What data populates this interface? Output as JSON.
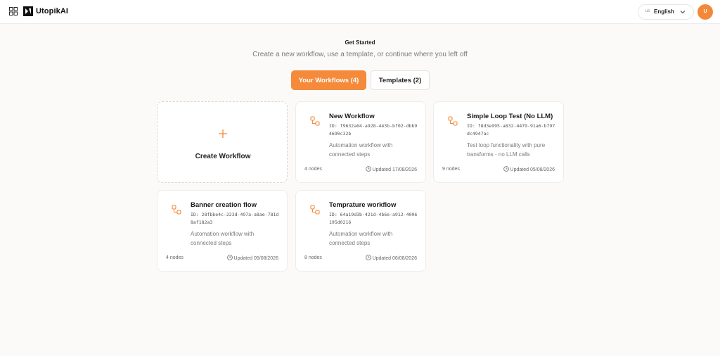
{
  "header": {
    "brand": "UtopikAI",
    "language": {
      "flag": "us",
      "label": "English"
    },
    "avatar_initial": "U"
  },
  "hero": {
    "title": "Get Started",
    "subtitle": "Create a new workflow, use a template, or continue where you left off"
  },
  "tabs": [
    {
      "label": "Your Workflows (4)",
      "active": true
    },
    {
      "label": "Templates (2)",
      "active": false
    }
  ],
  "create_card": {
    "label": "Create Workflow"
  },
  "workflows": [
    {
      "title": "New Workflow",
      "id": "ID: f9632a04-a928-443b-bf02-dbb94690c32b",
      "description": "Automation workflow with connected steps",
      "nodes": "4 nodes",
      "updated": "Updated 17/08/2026"
    },
    {
      "title": "Simple Loop Test (No LLM)",
      "id": "ID: f8d3e995-a832-4479-91a6-b797dc4947ac",
      "description": "Test loop functionality with pure transforms - no LLM calls",
      "nodes": "9 nodes",
      "updated": "Updated 05/08/2026"
    },
    {
      "title": "Banner creation flow",
      "id": "ID: 28fbbe4c-223d-497a-a8ae-781d8af182a3",
      "description": "Automation workflow with connected steps",
      "nodes": "4 nodes",
      "updated": "Updated 05/08/2026"
    },
    {
      "title": "Temprature workflow",
      "id": "ID: 64a19d3b-421d-4b6e-a912-4006195d0216",
      "description": "Automation workflow with connected steps",
      "nodes": "8 nodes",
      "updated": "Updated 06/08/2026"
    }
  ],
  "colors": {
    "accent": "#f48a3a",
    "background": "#fbfaf8"
  }
}
